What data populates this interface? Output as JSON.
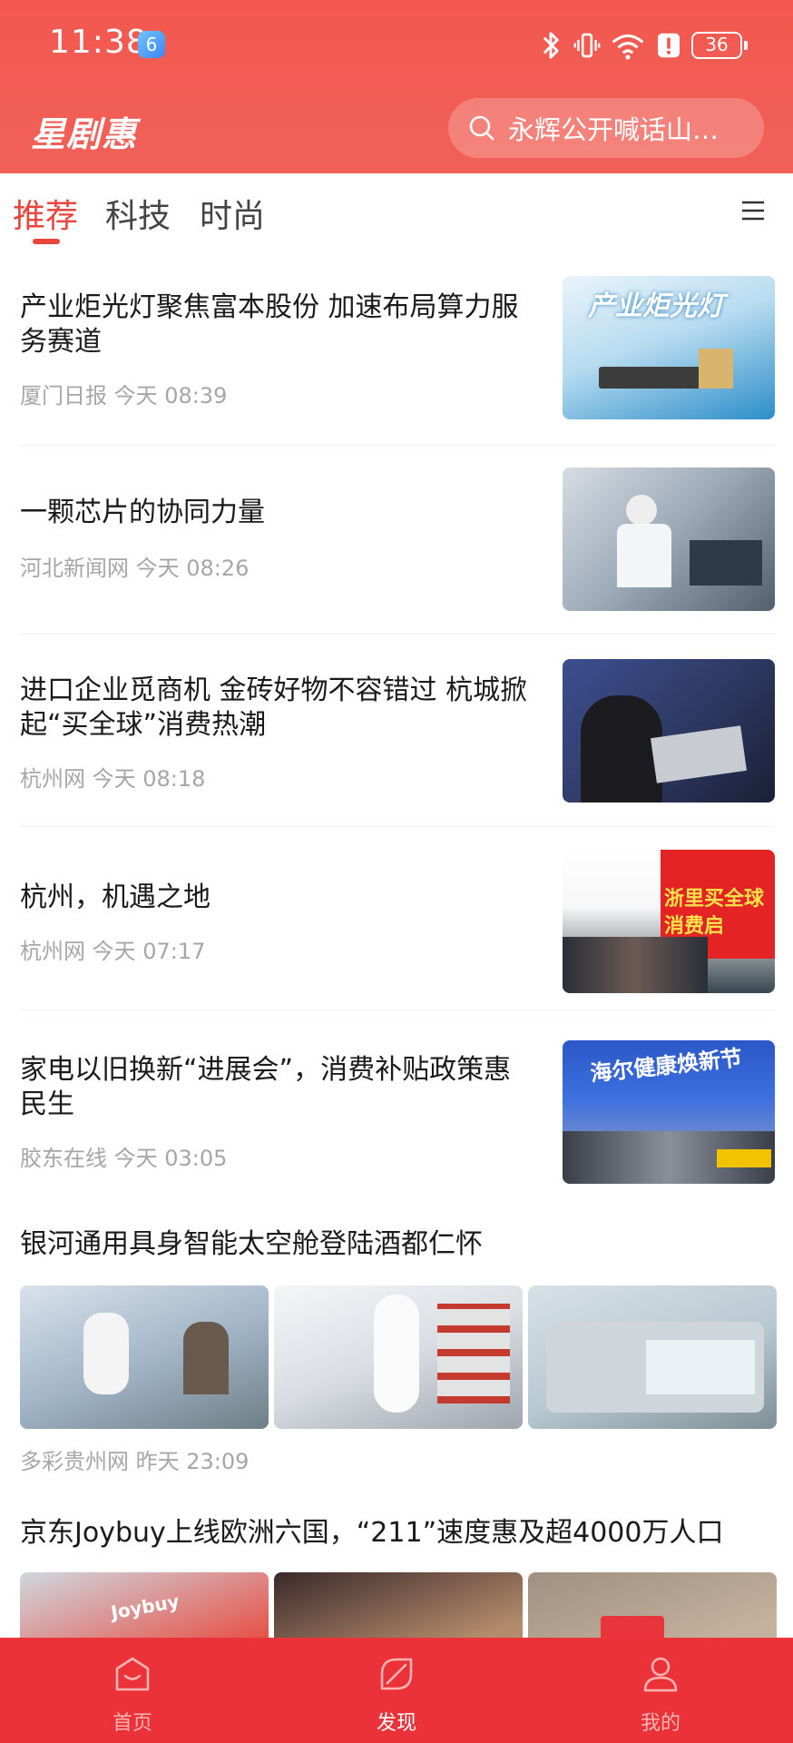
{
  "status_bar": {
    "time": "11:38",
    "notification_badge": "6",
    "battery": "36"
  },
  "header": {
    "brand": "星剧惠",
    "search_placeholder": "永辉公开喊话山…"
  },
  "tabs": [
    {
      "label": "推荐",
      "active": true
    },
    {
      "label": "科技",
      "active": false
    },
    {
      "label": "时尚",
      "active": false
    }
  ],
  "feed": [
    {
      "title": "产业炬光灯聚焦富本股份 加速布局算力服务赛道",
      "source": "厦门日报",
      "time": "今天 08:39",
      "thumb_text": "产业炬光灯"
    },
    {
      "title": "一颗芯片的协同力量",
      "source": "河北新闻网",
      "time": "今天 08:26"
    },
    {
      "title": "进口企业觅商机 金砖好物不容错过 杭城掀起“买全球”消费热潮",
      "source": "杭州网",
      "time": "今天 08:18"
    },
    {
      "title": "杭州，机遇之地",
      "source": "杭州网",
      "time": "今天 07:17",
      "thumb_text": "浙里买全球 消费启"
    },
    {
      "title": "家电以旧换新“进展会”，消费补贴政策惠民生",
      "source": "胶东在线",
      "time": "今天 03:05",
      "thumb_text": "海尔健康焕新节"
    }
  ],
  "triple_items": [
    {
      "title": "银河通用具身智能太空舱登陆酒都仁怀",
      "source": "多彩贵州网",
      "time": "昨天 23:09"
    },
    {
      "title": "京东Joybuy上线欧洲六国，“211”速度惠及超4000万人口",
      "thumb_text": "Joybuy"
    }
  ],
  "bottom_nav": [
    {
      "label": "首页",
      "icon": "home-icon",
      "active": false
    },
    {
      "label": "发现",
      "icon": "discover-icon",
      "active": true
    },
    {
      "label": "我的",
      "icon": "user-icon",
      "active": false
    }
  ],
  "colors": {
    "brand_red": "#f2584f",
    "accent": "#e8453c",
    "nav_red": "#ea3238"
  }
}
